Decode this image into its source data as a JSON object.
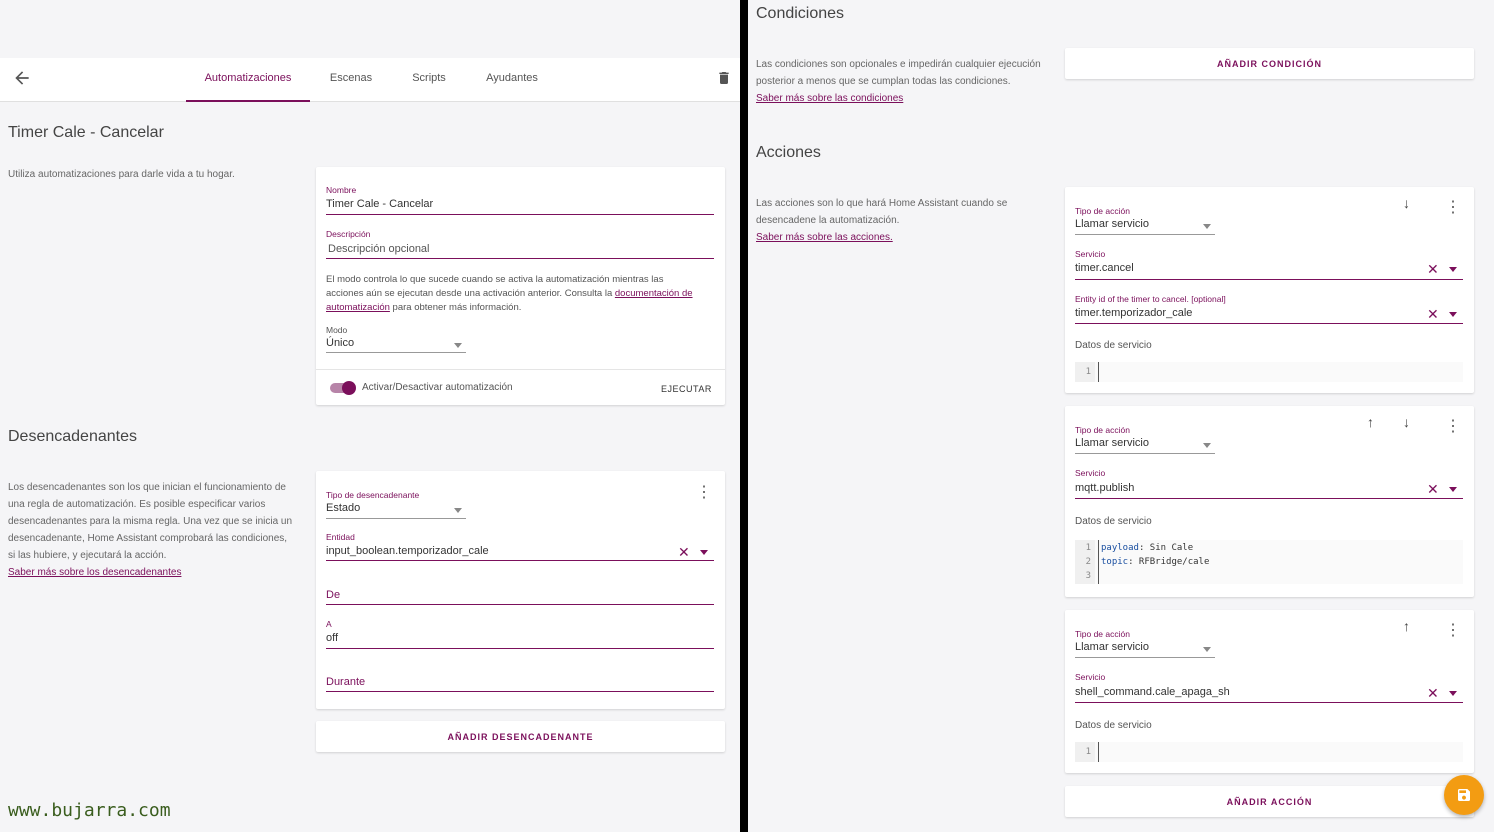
{
  "toolbar": {
    "tabs": [
      "Automatizaciones",
      "Escenas",
      "Scripts",
      "Ayudantes"
    ]
  },
  "automation": {
    "title": "Timer Cale - Cancelar",
    "intro": "Utiliza automatizaciones para darle vida a tu hogar.",
    "name_label": "Nombre",
    "name_value": "Timer Cale - Cancelar",
    "desc_label": "Descripción",
    "desc_placeholder": "Descripción opcional",
    "mode_text_1": "El modo controla lo que sucede cuando se activa la automatización mientras las",
    "mode_text_2": "acciones aún se ejecutan desde una activación anterior. Consulta la ",
    "mode_link_1": "documentación de",
    "mode_link_2": "automatización",
    "mode_text_3": " para obtener más información.",
    "mode_label": "Modo",
    "mode_value": "Único",
    "toggle_label": "Activar/Desactivar automatización",
    "run_button": "EJECUTAR"
  },
  "triggers": {
    "title": "Desencadenantes",
    "desc_lines": [
      "Los desencadenantes son los que inician el funcionamiento de",
      "una regla de automatización. Es posible especificar varios",
      "desencadenantes para la misma regla. Una vez que se inicia un",
      "desencadenante, Home Assistant comprobará las condiciones,",
      "si las hubiere, y ejecutará la acción."
    ],
    "link": "Saber más sobre los desencadenantes",
    "type_label": "Tipo de desencadenante",
    "type_value": "Estado",
    "entity_label": "Entidad",
    "entity_value": "input_boolean.temporizador_cale",
    "from_label": "De",
    "to_label": "A",
    "to_value": "off",
    "for_label": "Durante",
    "add_button": "AÑADIR DESENCADENANTE"
  },
  "conditions": {
    "title": "Condiciones",
    "desc_lines": [
      "Las condiciones son opcionales e impedirán cualquier ejecución",
      "posterior a menos que se cumplan todas las condiciones."
    ],
    "link": "Saber más sobre las condiciones",
    "add_button": "AÑADIR CONDICIÓN"
  },
  "actions": {
    "title": "Acciones",
    "desc_lines": [
      "Las acciones son lo que hará Home Assistant cuando se",
      "desencadene la automatización."
    ],
    "link": "Saber más sobre las acciones.",
    "type_label": "Tipo de acción",
    "type_value": "Llamar servicio",
    "service_label": "Servicio",
    "data_label": "Datos de servicio",
    "entity_label": "Entity id of the timer to cancel. [optional]",
    "items": [
      {
        "service": "timer.cancel",
        "entity": "timer.temporizador_cale",
        "code": [
          "1"
        ]
      },
      {
        "service": "mqtt.publish",
        "code": [
          "1",
          "2",
          "3"
        ],
        "yaml": [
          [
            "payload",
            ": Sin Cale"
          ],
          [
            "topic",
            ": RFBridge/cale"
          ]
        ]
      },
      {
        "service": "shell_command.cale_apaga_sh",
        "code": [
          "1"
        ]
      }
    ],
    "add_button": "AÑADIR ACCIÓN"
  },
  "icons": {
    "back": "arrow-left-icon",
    "trash": "trash-icon",
    "menu": "dots-vertical-icon",
    "up": "arrow-up-icon",
    "down": "arrow-down-icon",
    "clear": "close-icon",
    "save": "save-icon"
  },
  "colors": {
    "accent": "#7b0f5b",
    "fab": "#f39c12"
  },
  "watermark": "www.bujarra.com"
}
